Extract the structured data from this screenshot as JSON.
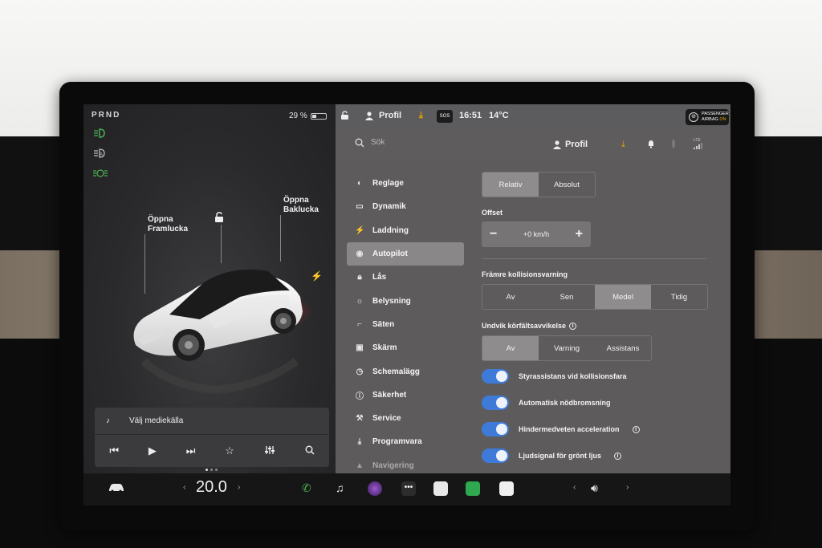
{
  "left_panel": {
    "gear": "PRND",
    "battery": "29 %",
    "battery_level": 0.29,
    "front_trunk": "Öppna\nFramlucka",
    "rear_trunk": "Öppna\nBaklucka",
    "media": {
      "source_label": "Välj mediekälla",
      "controls": [
        "prev-icon",
        "play-icon",
        "next-icon",
        "star-icon",
        "equalizer-icon",
        "search-icon"
      ]
    }
  },
  "topbar": {
    "profile": "Profil",
    "sos": "SOS",
    "time": "16:51",
    "temperature": "14°C",
    "airbag_line1": "PASSENGER",
    "airbag_line2": "AIRBAG",
    "airbag_state": "ON"
  },
  "search": {
    "placeholder": "Sök",
    "profile": "Profil",
    "lte": "LTE"
  },
  "nav": {
    "items": [
      {
        "label": "Reglage",
        "icon": "toggle-icon"
      },
      {
        "label": "Dynamik",
        "icon": "car-icon"
      },
      {
        "label": "Laddning",
        "icon": "bolt-icon"
      },
      {
        "label": "Autopilot",
        "icon": "steering-icon"
      },
      {
        "label": "Lås",
        "icon": "lock-icon"
      },
      {
        "label": "Belysning",
        "icon": "sun-icon"
      },
      {
        "label": "Säten",
        "icon": "seat-icon"
      },
      {
        "label": "Skärm",
        "icon": "display-icon"
      },
      {
        "label": "Schemalägg",
        "icon": "clock-icon"
      },
      {
        "label": "Säkerhet",
        "icon": "info-icon"
      },
      {
        "label": "Service",
        "icon": "wrench-icon"
      },
      {
        "label": "Programvara",
        "icon": "download-icon"
      },
      {
        "label": "Navigering",
        "icon": "navigation-icon"
      }
    ]
  },
  "content": {
    "speed_mode": {
      "options": [
        "Relativ",
        "Absolut"
      ],
      "selected": "Relativ"
    },
    "offset": {
      "label": "Offset",
      "value": "+0 km/h",
      "minus": "−",
      "plus": "+"
    },
    "fcw": {
      "label": "Främre kollisionsvarning",
      "options": [
        "Av",
        "Sen",
        "Medel",
        "Tidig"
      ],
      "selected": "Medel"
    },
    "lane": {
      "label": "Undvik körfältsavvikelse",
      "options": [
        "Av",
        "Varning",
        "Assistans"
      ],
      "selected": "Av"
    },
    "toggles": [
      {
        "label": "Styrassistans vid kollisionsfara",
        "on": true,
        "info": false
      },
      {
        "label": "Automatisk nödbromsning",
        "on": true,
        "info": false
      },
      {
        "label": "Hindermedveten acceleration",
        "on": true,
        "info": true
      },
      {
        "label": "Ljudsignal för grönt ljus",
        "on": true,
        "info": true
      }
    ]
  },
  "taskbar": {
    "cabin_temp": "20.0"
  }
}
